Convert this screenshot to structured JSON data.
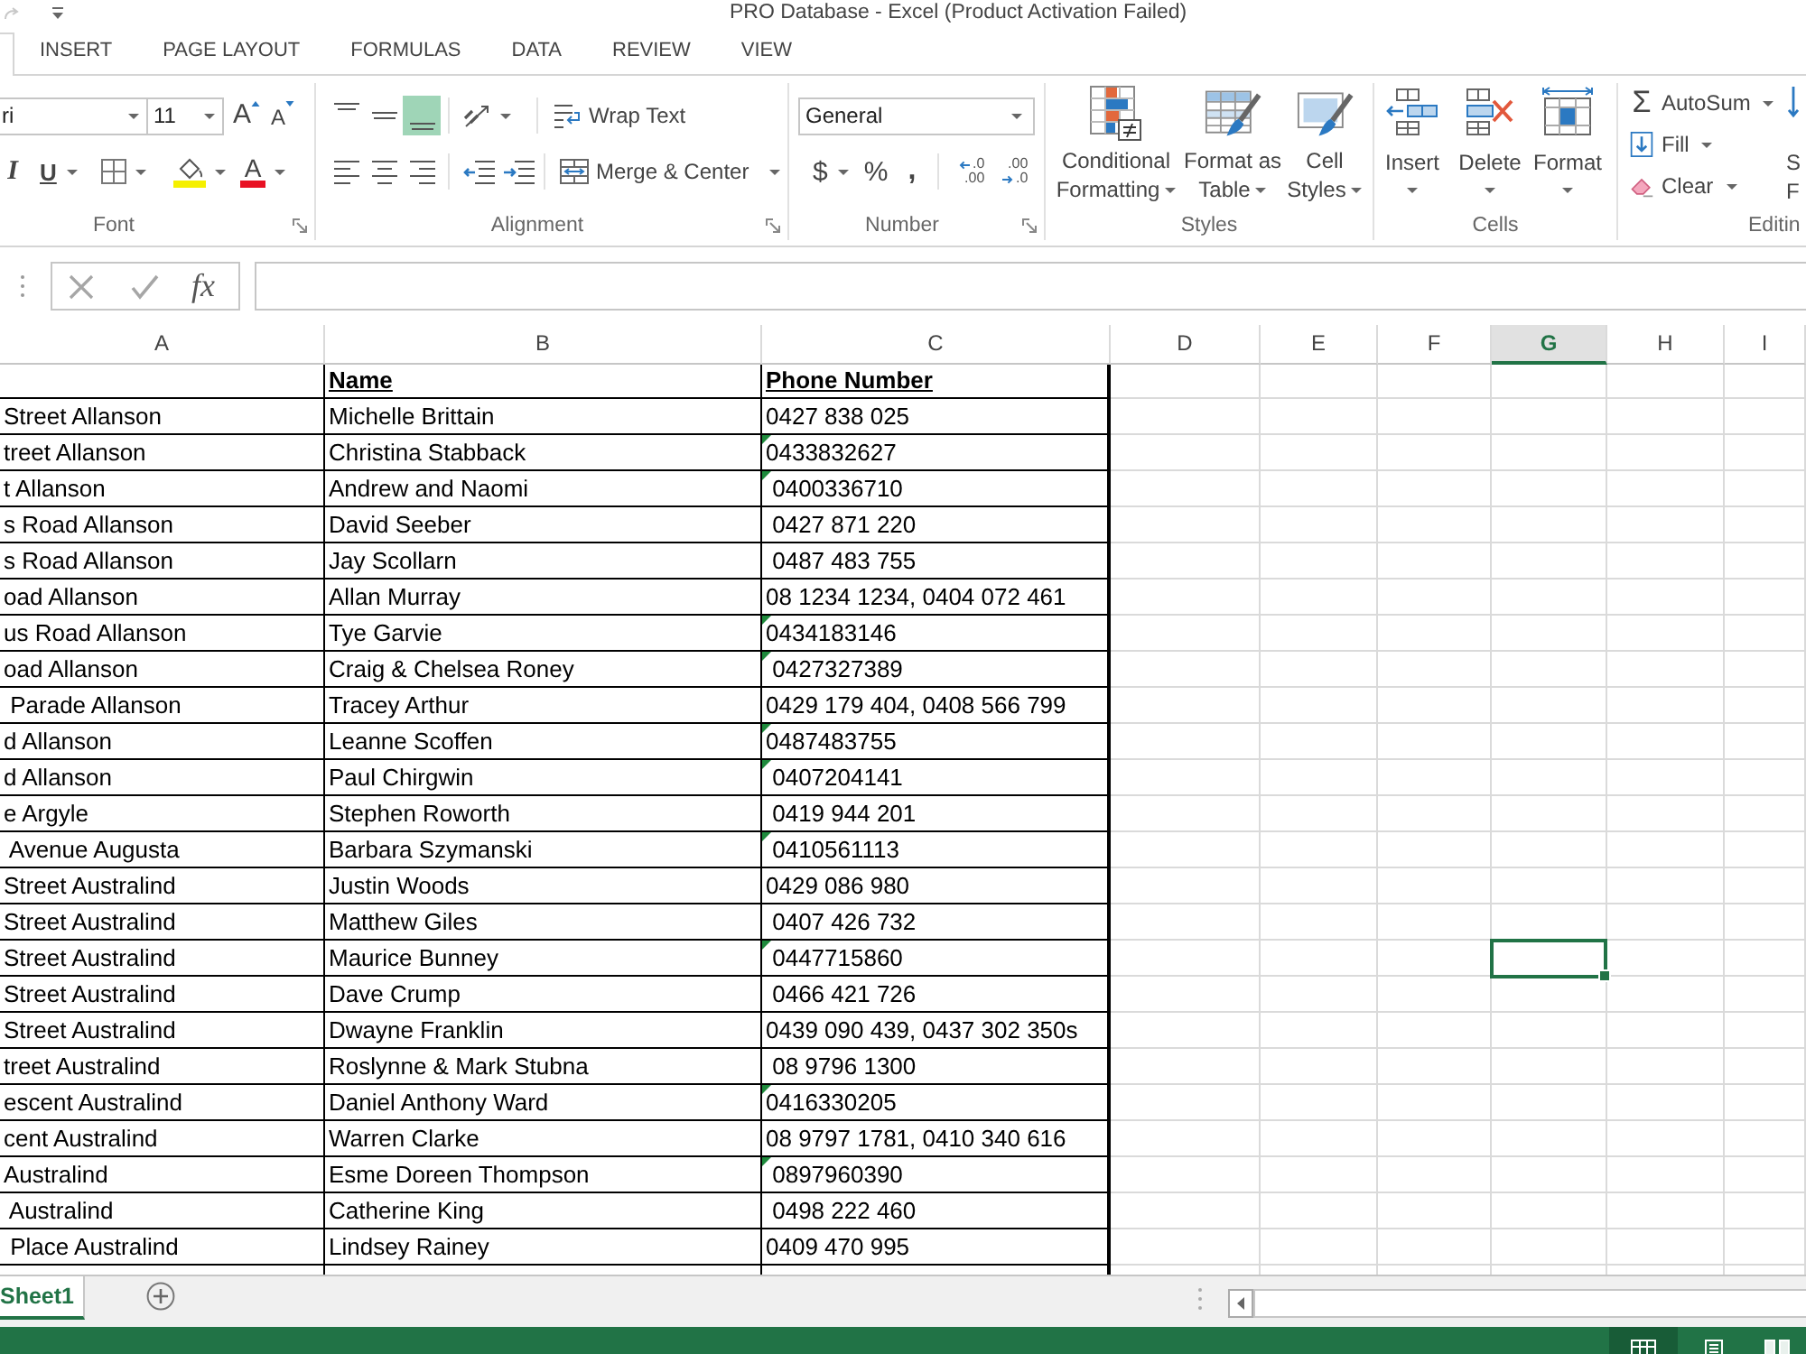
{
  "title_bar": {
    "title": "PRO Database - Excel (Product Activation Failed)"
  },
  "tabs": [
    {
      "selected": true
    },
    {
      "label": "INSERT",
      "selected": false
    },
    {
      "label": "PAGE LAYOUT",
      "selected": false
    },
    {
      "label": "FORMULAS",
      "selected": false
    },
    {
      "label": "DATA",
      "selected": false
    },
    {
      "label": "REVIEW",
      "selected": false
    },
    {
      "label": "VIEW",
      "selected": false
    }
  ],
  "ribbon": {
    "font": {
      "label": "Font",
      "font_name": "ri",
      "font_size": "11",
      "grow_font": "A",
      "shrink_font": "A",
      "italic": "I",
      "underline": "U",
      "font_color": "A"
    },
    "alignment": {
      "label": "Alignment",
      "vertical": [
        {
          "kind": "top",
          "on": false
        },
        {
          "kind": "middle",
          "on": false
        },
        {
          "kind": "bottom",
          "on": true
        }
      ],
      "horizontal": [
        {
          "kind": "left",
          "on": false
        },
        {
          "kind": "center",
          "on": false
        },
        {
          "kind": "right",
          "on": false
        }
      ],
      "wrap_text": "Wrap Text",
      "merge_center": "Merge & Center"
    },
    "number": {
      "label": "Number",
      "format": "General",
      "currency": "$",
      "percent": "%",
      "comma": ",",
      "decimal_buttons": [
        {
          "kind": "increase",
          "top": ".0",
          "bottom": ".00"
        },
        {
          "kind": "decrease",
          "top": ".00",
          "bottom": ".0"
        }
      ]
    },
    "styles": {
      "label": "Styles",
      "buttons": [
        {
          "kind": "conditional",
          "lines": [
            "Conditional",
            "Formatting"
          ]
        },
        {
          "kind": "table",
          "lines": [
            "Format as",
            "Table"
          ]
        },
        {
          "kind": "cell_styles",
          "lines": [
            "Cell",
            "Styles"
          ]
        }
      ]
    },
    "cells": {
      "label": "Cells",
      "buttons": [
        {
          "kind": "insert",
          "label": "Insert"
        },
        {
          "kind": "delete",
          "label": "Delete"
        },
        {
          "kind": "format",
          "label": "Format"
        }
      ]
    },
    "editing": {
      "label": "Editin",
      "buttons": [
        {
          "kind": "autosum",
          "symbol": "Σ",
          "label": "AutoSum"
        },
        {
          "kind": "fill",
          "label": "Fill"
        },
        {
          "kind": "clear",
          "label": "Clear"
        }
      ],
      "sort_filter": [
        "S",
        "F"
      ]
    }
  },
  "formula_bar": {
    "function_label": "fx"
  },
  "sheet": {
    "columns": [
      {
        "label": "A",
        "selected": false
      },
      {
        "label": "B",
        "selected": false
      },
      {
        "label": "C",
        "selected": false
      },
      {
        "label": "D",
        "selected": false
      },
      {
        "label": "E",
        "selected": false
      },
      {
        "label": "F",
        "selected": false
      },
      {
        "label": "G",
        "selected": true
      },
      {
        "label": "H",
        "selected": false
      },
      {
        "label": "I",
        "selected": false
      }
    ],
    "header_row": {
      "b": "Name",
      "c": "Phone Number"
    },
    "rows": [
      {
        "a": "Street Allanson",
        "b": "Michelle Brittain",
        "c": "0427 838 025",
        "flagged": false,
        "selected": false
      },
      {
        "a": "treet Allanson",
        "b": "Christina Stabback",
        "c": "0433832627",
        "flagged": true,
        "selected": false
      },
      {
        "a": "t Allanson",
        "b": "Andrew and Naomi",
        "c": " 0400336710",
        "flagged": true,
        "selected": false
      },
      {
        "a": "s Road Allanson",
        "b": "David Seeber",
        "c": " 0427 871 220",
        "flagged": false,
        "selected": false
      },
      {
        "a": "s Road Allanson",
        "b": "Jay Scollarn",
        "c": " 0487 483 755",
        "flagged": false,
        "selected": false
      },
      {
        "a": "oad Allanson",
        "b": "Allan Murray",
        "c": "08 1234 1234, 0404 072 461",
        "flagged": false,
        "selected": false
      },
      {
        "a": "us Road Allanson",
        "b": "Tye Garvie",
        "c": "0434183146",
        "flagged": true,
        "selected": false
      },
      {
        "a": "oad Allanson",
        "b": "Craig & Chelsea Roney",
        "c": " 0427327389",
        "flagged": true,
        "selected": false
      },
      {
        "a": " Parade Allanson",
        "b": "Tracey Arthur",
        "c": "0429 179 404, 0408 566 799",
        "flagged": false,
        "selected": false
      },
      {
        "a": "d Allanson",
        "b": "Leanne Scoffen",
        "c": "0487483755",
        "flagged": true,
        "selected": false
      },
      {
        "a": "d Allanson",
        "b": "Paul Chirgwin",
        "c": " 0407204141",
        "flagged": true,
        "selected": false
      },
      {
        "a": "e Argyle",
        "b": "Stephen Roworth",
        "c": " 0419 944 201",
        "flagged": false,
        "selected": false
      },
      {
        "a": " Avenue Augusta",
        "b": "Barbara Szymanski",
        "c": " 0410561113",
        "flagged": true,
        "selected": false
      },
      {
        "a": "Street Australind",
        "b": "Justin Woods",
        "c": "0429 086 980",
        "flagged": false,
        "selected": false
      },
      {
        "a": "Street Australind",
        "b": "Matthew Giles",
        "c": " 0407 426 732",
        "flagged": false,
        "selected": false
      },
      {
        "a": "Street Australind",
        "b": "Maurice Bunney",
        "c": " 0447715860",
        "flagged": true,
        "selected": true
      },
      {
        "a": "Street Australind",
        "b": "Dave Crump",
        "c": " 0466 421 726",
        "flagged": false,
        "selected": false
      },
      {
        "a": "Street Australind",
        "b": "Dwayne Franklin",
        "c": "0439 090 439, 0437 302 350s",
        "flagged": false,
        "selected": false
      },
      {
        "a": "treet Australind",
        "b": "Roslynne & Mark Stubna",
        "c": " 08 9796 1300",
        "flagged": false,
        "selected": false
      },
      {
        "a": "escent Australind",
        "b": "Daniel Anthony Ward",
        "c": "0416330205",
        "flagged": true,
        "selected": false
      },
      {
        "a": "cent Australind",
        "b": "Warren Clarke",
        "c": "08 9797 1781, 0410 340 616",
        "flagged": false,
        "selected": false
      },
      {
        "a": "Australind",
        "b": "Esme Doreen Thompson",
        "c": " 0897960390",
        "flagged": true,
        "selected": false
      },
      {
        "a": " Australind",
        "b": "Catherine King",
        "c": " 0498 222 460",
        "flagged": false,
        "selected": false
      },
      {
        "a": " Place Australind",
        "b": "Lindsey Rainey",
        "c": "0409 470 995",
        "flagged": false,
        "selected": false
      }
    ]
  },
  "sheet_tabs": [
    {
      "label": "Sheet1",
      "selected": true
    }
  ],
  "status_bar": {
    "views": [
      {
        "kind": "normal",
        "selected": true
      },
      {
        "kind": "page_layout",
        "selected": false
      },
      {
        "kind": "page_break",
        "selected": false
      }
    ]
  }
}
